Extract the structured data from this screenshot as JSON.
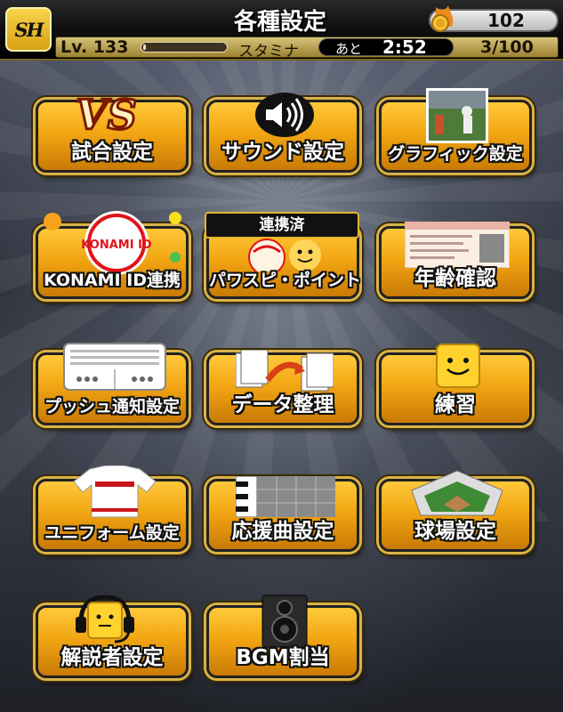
{
  "header": {
    "logo_text": "SH",
    "title": "各種設定",
    "coins": "102",
    "level": "Lv. 133",
    "stamina_label": "スタミナ",
    "stamina_fraction": 0.03,
    "timer_label": "あと",
    "timer_value": "2:52",
    "count": "3/100"
  },
  "tiles": {
    "match": {
      "label": "試合設定",
      "art_text": "VS"
    },
    "sound": {
      "label": "サウンド設定"
    },
    "graphic": {
      "label": "グラフィック設定"
    },
    "konami": {
      "label": "KONAMI ID連携",
      "art_text": "KONAMI ID"
    },
    "pawasupi": {
      "label": "パワスピ・ポイント",
      "badge": "連携済"
    },
    "age": {
      "label": "年齢確認"
    },
    "push": {
      "label": "プッシュ通知設定"
    },
    "data": {
      "label": "データ整理"
    },
    "practice": {
      "label": "練習"
    },
    "uniform": {
      "label": "ユニフォーム設定"
    },
    "song": {
      "label": "応援曲設定"
    },
    "stadium": {
      "label": "球場設定"
    },
    "commentator": {
      "label": "解説者設定"
    },
    "bgm": {
      "label": "BGM割当"
    }
  },
  "colors": {
    "tile_gold": "#f2a613",
    "tile_border": "#222222",
    "header_bg": "#111111"
  }
}
